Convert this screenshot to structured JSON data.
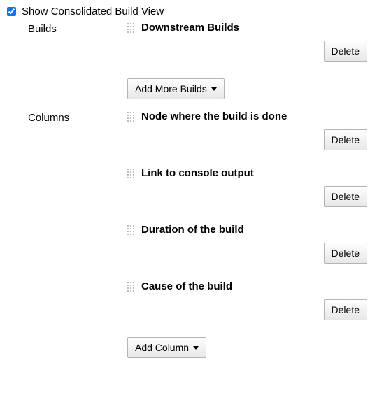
{
  "top": {
    "checkbox_checked": true,
    "label": "Show Consolidated Build View"
  },
  "builds": {
    "section_label": "Builds",
    "items": [
      {
        "title": "Downstream Builds",
        "delete_label": "Delete"
      }
    ],
    "add_label": "Add More Builds"
  },
  "columns": {
    "section_label": "Columns",
    "items": [
      {
        "title": "Node where the build is done",
        "delete_label": "Delete"
      },
      {
        "title": "Link to console output",
        "delete_label": "Delete"
      },
      {
        "title": "Duration of the build",
        "delete_label": "Delete"
      },
      {
        "title": "Cause of the build",
        "delete_label": "Delete"
      }
    ],
    "add_label": "Add Column"
  }
}
